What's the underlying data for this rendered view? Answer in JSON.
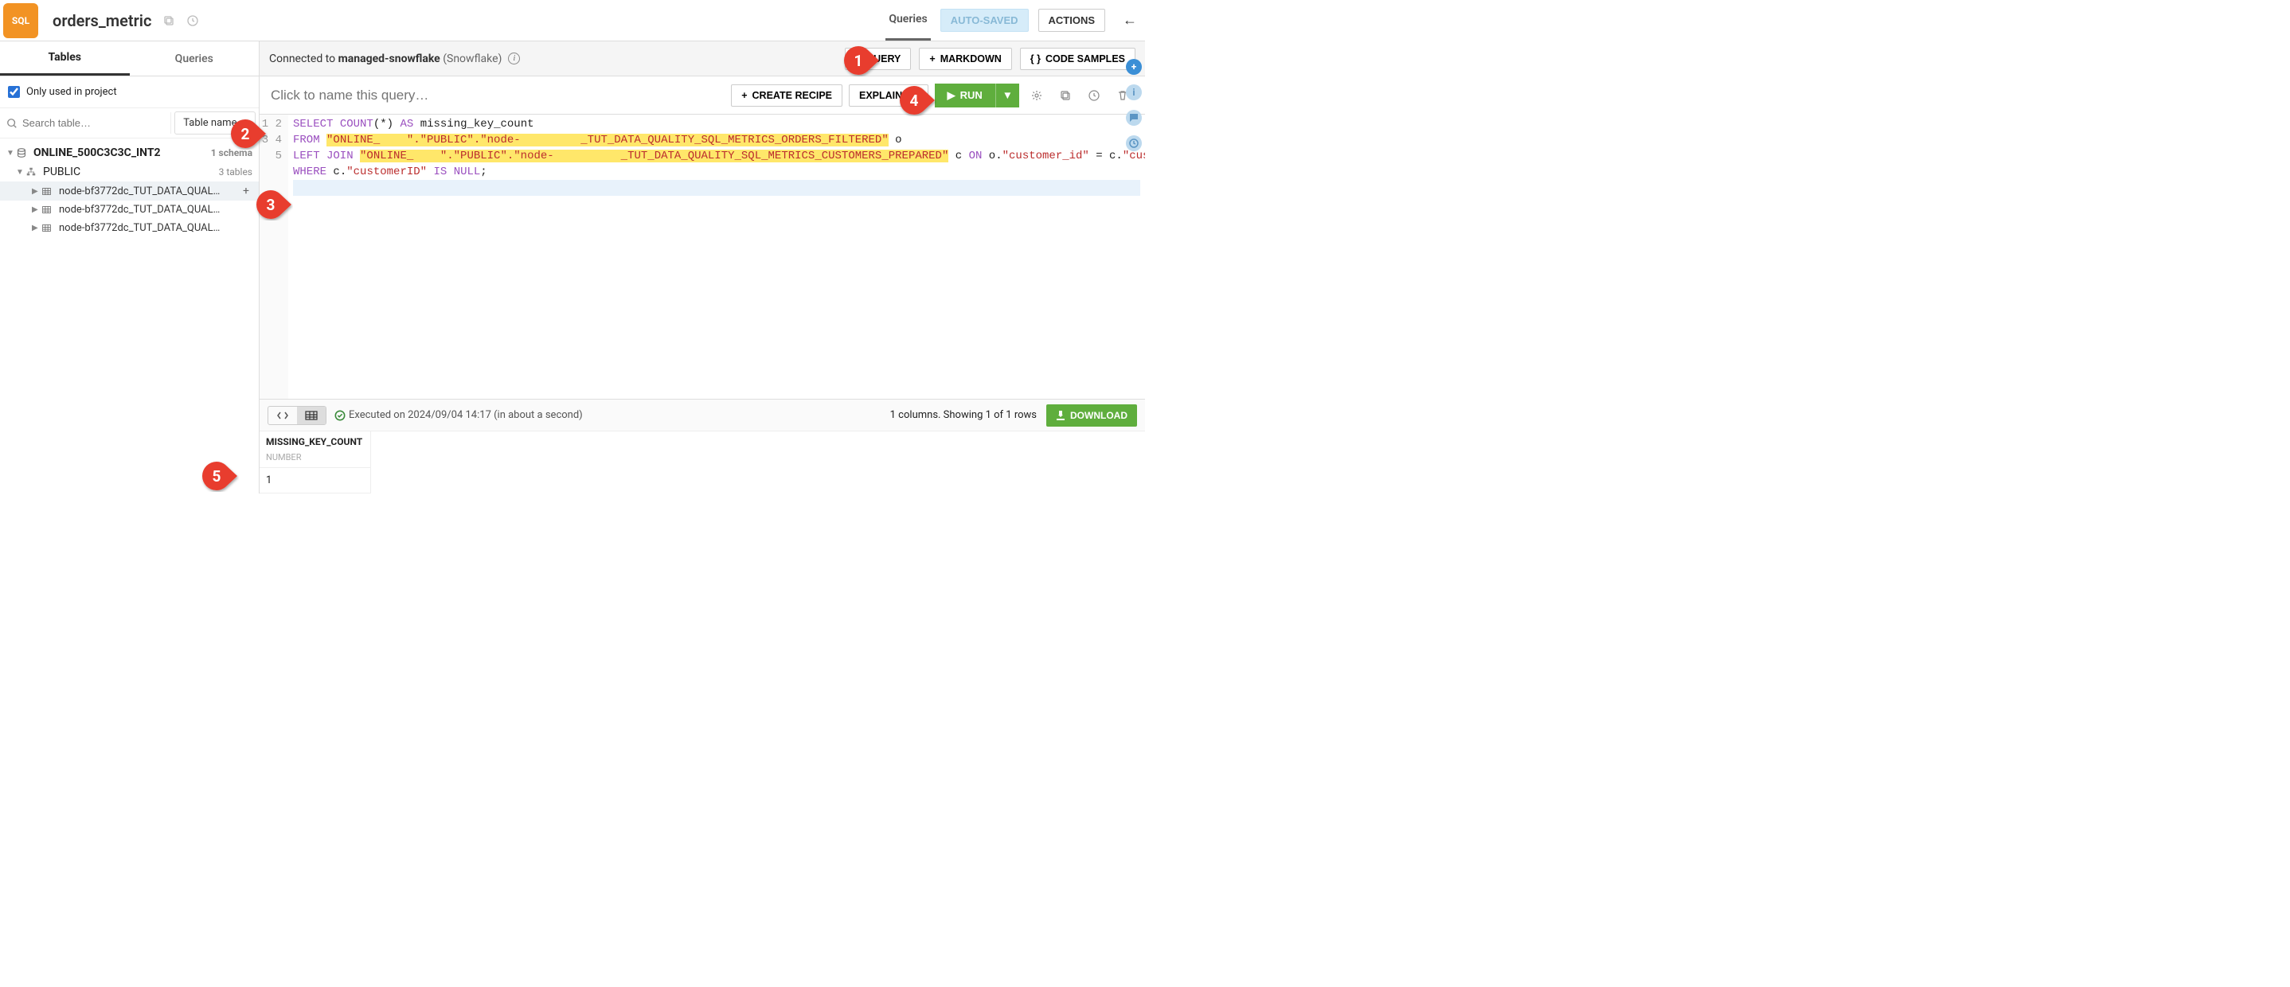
{
  "header": {
    "logo_text": "SQL",
    "title": "orders_metric",
    "top_tab": "Queries",
    "autosaved": "AUTO-SAVED",
    "actions": "ACTIONS"
  },
  "left": {
    "tabs": {
      "tables": "Tables",
      "queries": "Queries"
    },
    "only_used": "Only used in project",
    "search_placeholder": "Search table…",
    "sort_label": "Table name",
    "db": {
      "name": "ONLINE_500C3C3C_INT2",
      "meta": "1 schema"
    },
    "schema": {
      "name": "PUBLIC",
      "meta": "3 tables"
    },
    "tables": [
      "node-bf3772dc_TUT_DATA_QUAL…",
      "node-bf3772dc_TUT_DATA_QUAL…",
      "node-bf3772dc_TUT_DATA_QUAL…"
    ]
  },
  "connect": {
    "prefix": "Connected to",
    "name": "managed-snowflake",
    "engine": "(Snowflake)",
    "add_query": "QUERY",
    "add_md": "MARKDOWN",
    "code_samples": "CODE SAMPLES"
  },
  "toolbar": {
    "name_placeholder": "Click to name this query…",
    "create_recipe": "CREATE RECIPE",
    "explain": "EXPLAIN PL",
    "run": "RUN"
  },
  "code": {
    "l1_select": "SELECT",
    "l1_count": "COUNT",
    "l1_star": "(*)",
    "l1_as": "AS",
    "l1_alias": "missing_key_count",
    "l2_from": "FROM",
    "l2_id": "\"ONLINE_    \".\"PUBLIC\".\"node-         _TUT_DATA_QUALITY_SQL_METRICS_ORDERS_FILTERED\"",
    "l2_alias": " o",
    "l3_join": "LEFT JOIN",
    "l3_id": "\"ONLINE_    \".\"PUBLIC\".\"node-          _TUT_DATA_QUALITY_SQL_METRICS_CUSTOMERS_PREPARED\"",
    "l3_rest_c": " c ",
    "l3_on": "ON",
    "l3_o": " o.",
    "l3_col1": "\"customer_id\"",
    "l3_eq": " = c.",
    "l3_col2": "\"customerID\"",
    "l4_where": "WHERE",
    "l4_c": " c.",
    "l4_col": "\"customerID\"",
    "l4_is": "IS",
    "l4_null": "NULL",
    "l4_semi": ";"
  },
  "results": {
    "exec": "Executed on 2024/09/04 14:17 (in about a second)",
    "stats": "1 columns. Showing 1 of 1 rows",
    "download": "DOWNLOAD",
    "col_name": "MISSING_KEY_COUNT",
    "col_type": "NUMBER",
    "value": "1"
  },
  "callouts": {
    "1": "1",
    "2": "2",
    "3": "3",
    "4": "4",
    "5": "5"
  }
}
